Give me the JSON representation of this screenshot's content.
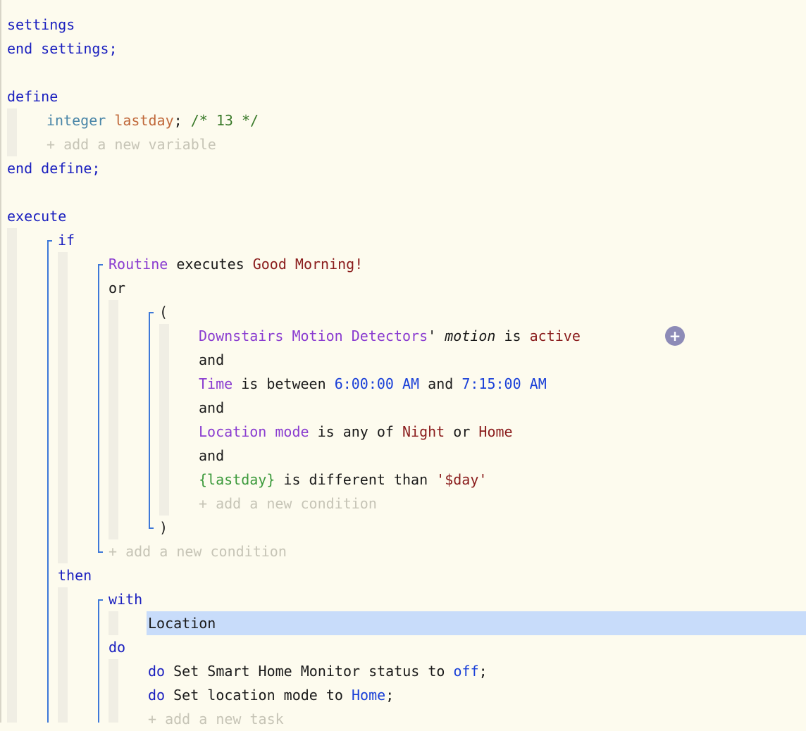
{
  "code": {
    "settings": {
      "open": "settings",
      "close": "end settings;"
    },
    "define": {
      "open": "define",
      "type": "integer",
      "var": "lastday",
      "semicolon": ";",
      "comment": "/* 13 */",
      "add_label": "+ add a new variable",
      "close": "end define;"
    },
    "execute": {
      "kw": "execute",
      "if": "if",
      "routine": "Routine",
      "executes": "executes",
      "routine_name": "Good Morning!",
      "or": "or",
      "paren_open": "(",
      "paren_close": ")",
      "c1": {
        "device": "Downstairs Motion Detectors",
        "apos": "'",
        "attr": "motion",
        "is": "is",
        "value": "active"
      },
      "and": "and",
      "c2": {
        "subject": "Time",
        "op": "is between",
        "t1": "6:00:00 AM",
        "and": "and",
        "t2": "7:15:00 AM"
      },
      "c3": {
        "subject": "Location mode",
        "op": "is any of",
        "v1": "Night",
        "or": "or",
        "v2": "Home"
      },
      "c4": {
        "var": "{lastday}",
        "op": "is different than",
        "value": "'$day'"
      },
      "add_condition": "+ add a new condition",
      "then": "then",
      "with": "with",
      "location": "Location",
      "do": "do",
      "t1": {
        "do": "do",
        "action": "Set Smart Home Monitor status to",
        "value": "off",
        "end": ";"
      },
      "t2": {
        "do": "do",
        "action": "Set location mode to",
        "value": "Home",
        "end": ";"
      },
      "add_task": "+ add a new task"
    }
  },
  "colors": {
    "background": "#fdfbee",
    "keyword": "#1a1fbf",
    "device": "#8a3cd0",
    "value": "#8a1c1c",
    "time": "#1a40d8",
    "variable": "#c0683a",
    "comment": "#3a7a2a",
    "highlight": "#c8dcfa"
  },
  "icons": {
    "add_condition_button": "plus-circle-icon"
  }
}
